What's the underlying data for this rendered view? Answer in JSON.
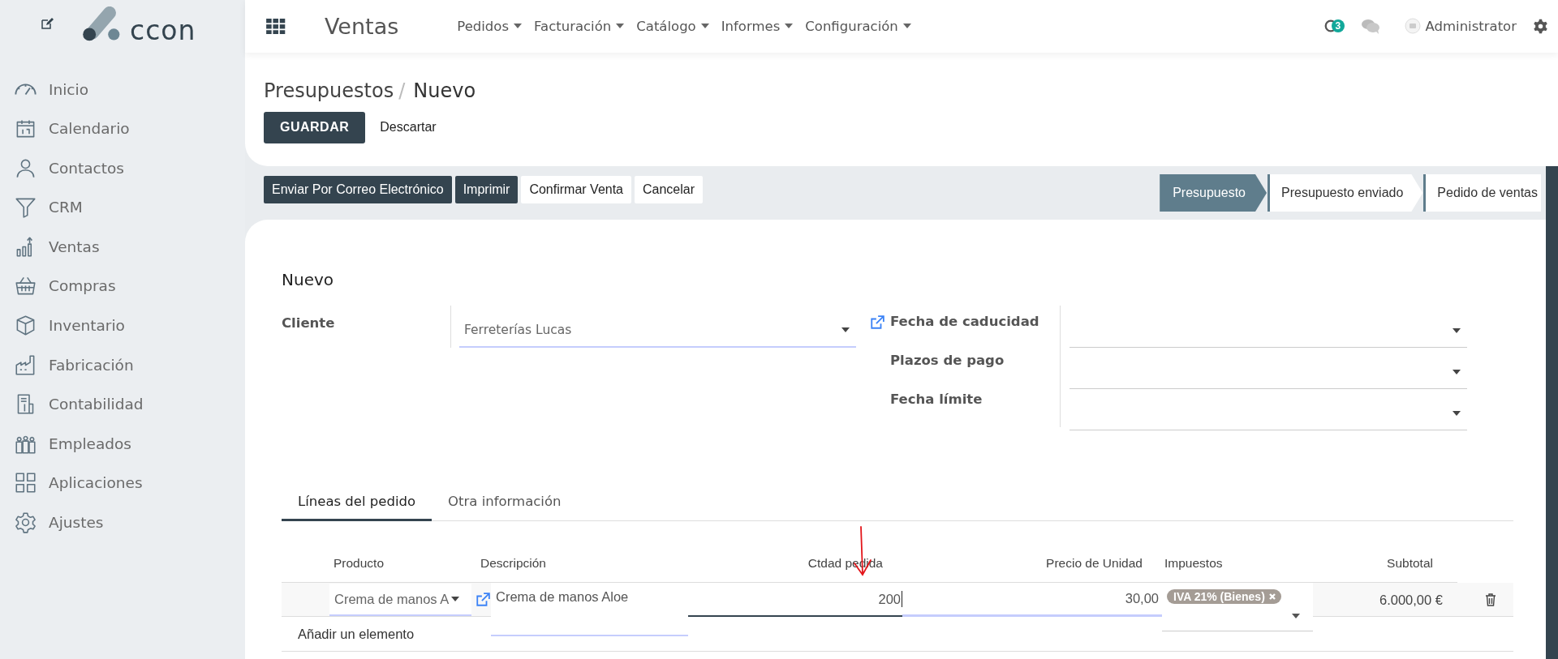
{
  "sidebar": {
    "logo_text": "ccon",
    "items": [
      {
        "label": "Inicio"
      },
      {
        "label": "Calendario"
      },
      {
        "label": "Contactos"
      },
      {
        "label": "CRM"
      },
      {
        "label": "Ventas"
      },
      {
        "label": "Compras"
      },
      {
        "label": "Inventario"
      },
      {
        "label": "Fabricación"
      },
      {
        "label": "Contabilidad"
      },
      {
        "label": "Empleados"
      },
      {
        "label": "Aplicaciones"
      },
      {
        "label": "Ajustes"
      }
    ]
  },
  "top_bar": {
    "app_name": "Ventas",
    "menus": [
      "Pedidos",
      "Facturación",
      "Catálogo",
      "Informes",
      "Configuración"
    ],
    "activity_count": "3",
    "user": "Administrator"
  },
  "breadcrumb": [
    "Presupuestos",
    "Nuevo"
  ],
  "breadcrumb_separator": "/",
  "control_buttons": [
    {
      "label": "GUARDAR",
      "primary": true
    },
    {
      "label": "Descartar",
      "primary": false
    }
  ],
  "actions": [
    {
      "label": "Enviar Por Correo Electrónico",
      "primary": true
    },
    {
      "label": "Imprimir",
      "primary": true
    },
    {
      "label": "Confirmar Venta",
      "primary": false
    },
    {
      "label": "Cancelar",
      "primary": false
    }
  ],
  "status_bar": [
    {
      "label": "Presupuesto",
      "selected": true
    },
    {
      "label": "Presupuesto enviado",
      "selected": false
    },
    {
      "label": "Pedido de ventas",
      "selected": false
    }
  ],
  "form": {
    "title": "Nuevo",
    "customer": {
      "label": "Cliente",
      "value": "Ferreterías Lucas"
    },
    "right_fields": [
      {
        "label": "Fecha de caducidad"
      },
      {
        "label": "Plazos de pago"
      },
      {
        "label": "Fecha límite"
      }
    ]
  },
  "tabs": [
    {
      "label": "Líneas del pedido",
      "selected": true
    },
    {
      "label": "Otra información",
      "selected": false
    }
  ],
  "table": {
    "columns": [
      "Producto",
      "Descripción",
      "Ctdad pedida",
      "Precio de Unidad",
      "Impuestos",
      "Subtotal"
    ],
    "rows": [
      {
        "product": "Crema de manos A",
        "description": "Crema de manos Aloe",
        "quantity": "200",
        "quantity_focused": true,
        "unit_price": "30,00",
        "taxes": [
          "IVA 21% (Bienes)"
        ],
        "subtotal": "6.000,00 €"
      }
    ],
    "add_line": "Añadir un elemento"
  }
}
